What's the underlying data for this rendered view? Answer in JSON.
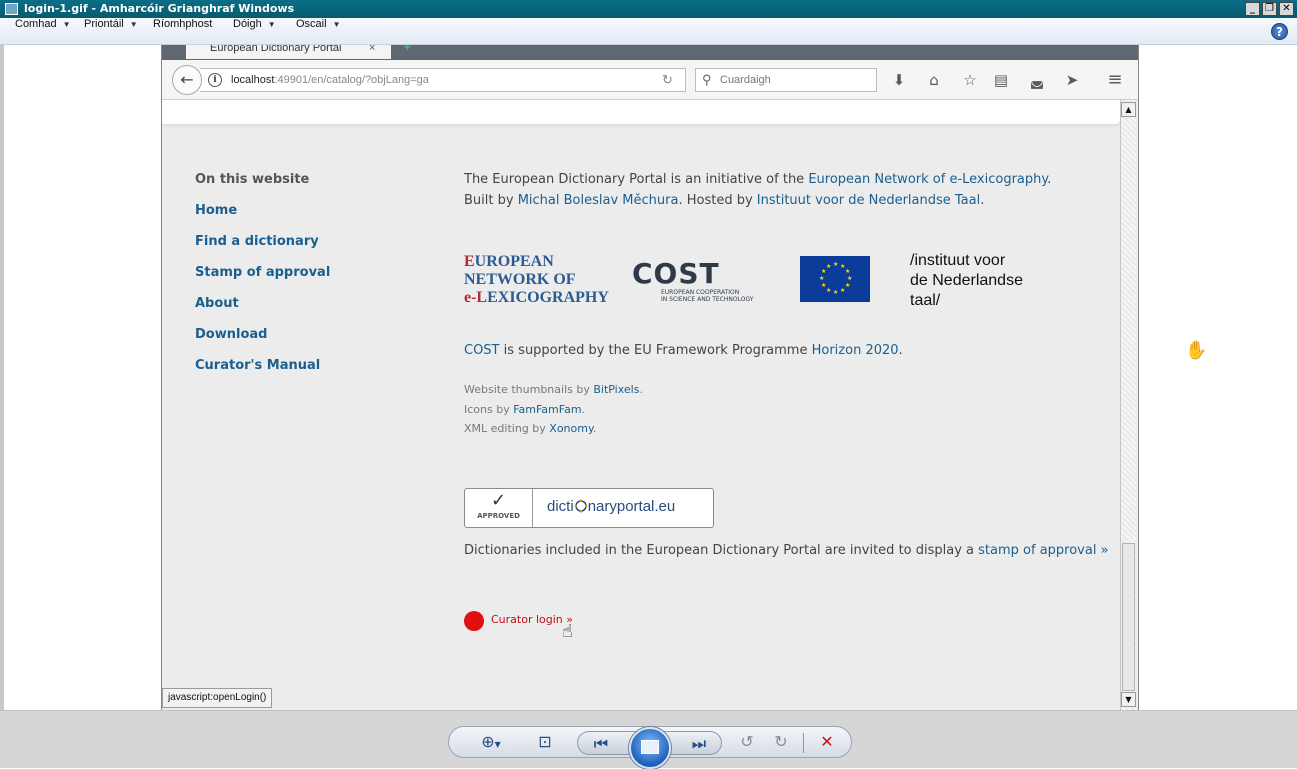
{
  "window": {
    "title": "login-1.gif - Amharcóir Grianghraf Windows"
  },
  "menu": {
    "items": [
      {
        "label": "Comhad",
        "arrow": "▼"
      },
      {
        "label": "Priontáil",
        "arrow": "▼"
      },
      {
        "label": "Ríomhphost",
        "arrow": ""
      },
      {
        "label": "Dóigh",
        "arrow": "▼"
      },
      {
        "label": "Oscail",
        "arrow": "▼"
      }
    ],
    "help": "?"
  },
  "browser": {
    "tab_title": "European Dictionary Portal",
    "tab_close": "×",
    "new_tab": "+",
    "url_host": "localhost",
    "url_rest": ":49901/en/catalog/?objLang=ga",
    "search_placeholder": "Cuardaigh",
    "status_text": "javascript:openLogin()"
  },
  "footer": {
    "nav_heading": "On this website",
    "nav_links": [
      "Home",
      "Find a dictionary",
      "Stamp of approval",
      "About",
      "Download",
      "Curator's Manual"
    ],
    "intro": {
      "t1": "The European Dictionary Portal is an initiative of the ",
      "link1": "European Network of e-Lexicography",
      "t2": ".",
      "t3": "Built by ",
      "link2": "Michal Boleslav Měchura",
      "t4": ". Hosted by ",
      "link3": "Instituut voor de Nederlandse Taal",
      "t5": "."
    },
    "logos": {
      "enel_line1_initial": "E",
      "enel_line1_rest": "UROPEAN",
      "enel_line2": "NETWORK OF",
      "enel_line3_initial": "e-L",
      "enel_line3_rest": "EXICOGRAPHY",
      "cost_word": "COST",
      "cost_sub1": "EUROPEAN COOPERATION",
      "cost_sub2": "IN SCIENCE AND TECHNOLOGY",
      "ivdnt_line1": "/instituut voor",
      "ivdnt_line2": "de Nederlandse",
      "ivdnt_line3": "taal/"
    },
    "cost_note": {
      "link1": "COST",
      "t1": " is supported by the EU Framework Programme ",
      "link2": "Horizon 2020",
      "t2": "."
    },
    "credits": [
      {
        "text": "Website thumbnails by ",
        "link": "BitPixels",
        "end": "."
      },
      {
        "text": "Icons by ",
        "link": "FamFamFam",
        "end": "."
      },
      {
        "text": "XML editing by ",
        "link": "Xonomy",
        "end": "."
      }
    ],
    "badge": {
      "tick": "✓",
      "approved": "APPROVED",
      "site_a": "dicti",
      "site_b": "naryportal.eu"
    },
    "stamp_note": {
      "text": "Dictionaries included in the European Dictionary Portal are invited to display a ",
      "link": "stamp of approval »"
    },
    "curator_login": "Curator login »"
  },
  "viewer_toolbar": {
    "buttons": [
      "zoom",
      "fit",
      "previous",
      "slideshow",
      "next",
      "rotate-left",
      "rotate-right",
      "delete"
    ]
  },
  "colors": {
    "link": "#1a5f8f",
    "login_dot": "#e01010",
    "titlebar": "#0a6f86"
  }
}
